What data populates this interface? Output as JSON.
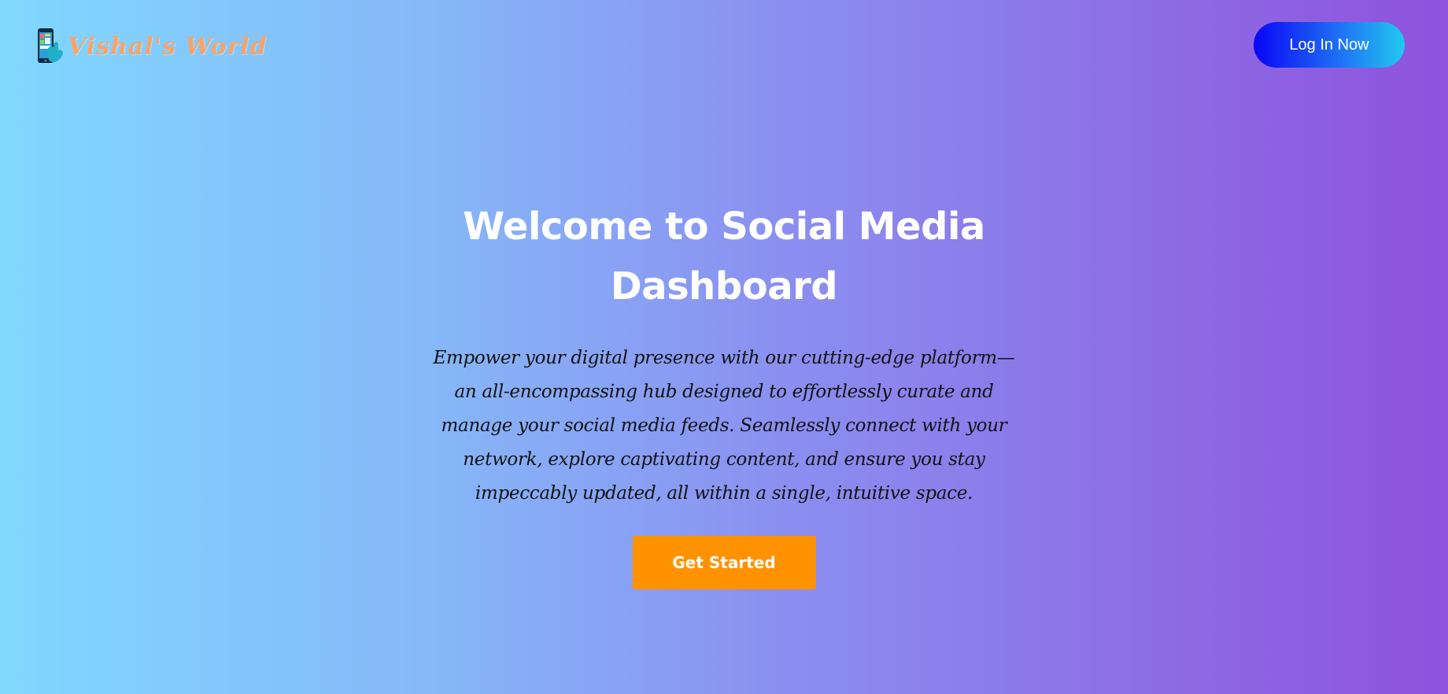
{
  "header": {
    "logo_text": "Vishal's World",
    "login_label": "Log In Now"
  },
  "hero": {
    "title": "Welcome to Social Media Dashboard",
    "description": "Empower your digital presence with our cutting-edge platform—an all-encompassing hub designed to effortlessly curate and manage your social media feeds. Seamlessly connect with your network, explore captivating content, and ensure you stay impeccably updated, all within a single, intuitive space.",
    "cta_label": "Get Started"
  },
  "colors": {
    "gradient_start": "#80d8ff",
    "gradient_end": "#8e52dc",
    "login_button": "#0a06f5",
    "cta_button": "#ff9200",
    "logo_text": "#f5a36b"
  },
  "icons": {
    "logo": "phone-with-social-hand-icon"
  }
}
